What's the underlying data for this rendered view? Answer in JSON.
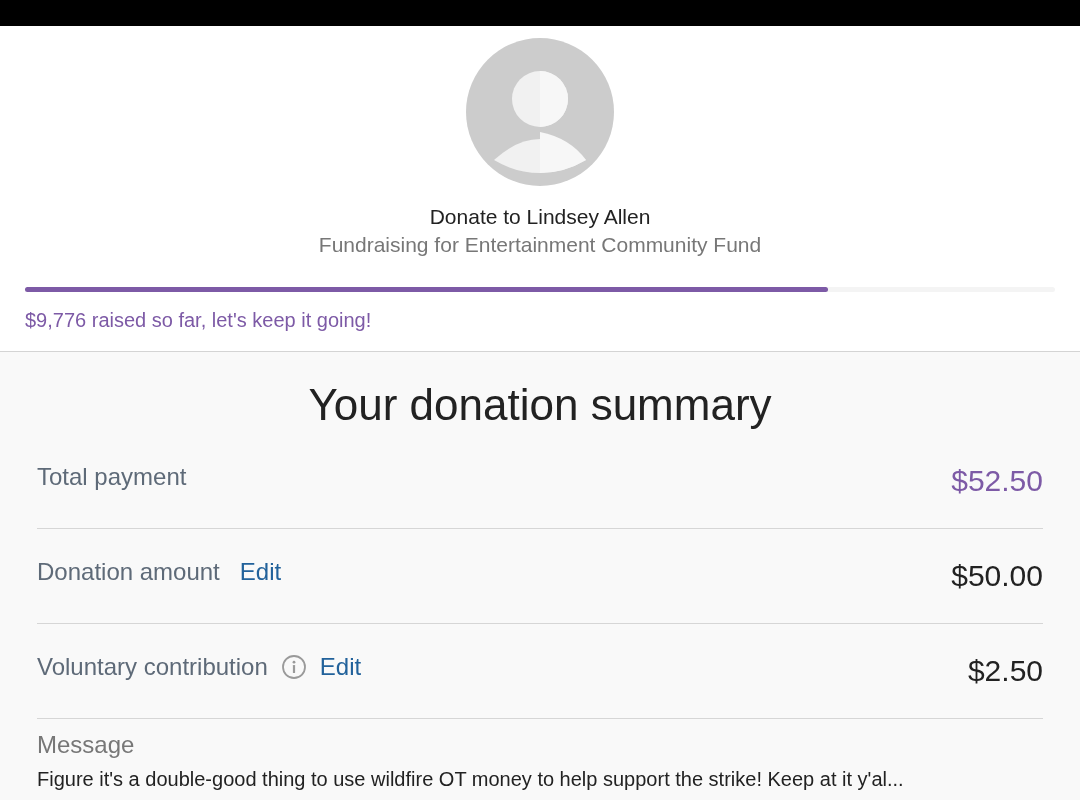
{
  "header": {
    "title": "Donate to Lindsey Allen",
    "subtitle": "Fundraising for Entertainment Community Fund"
  },
  "progress": {
    "level": 0.78,
    "caption": "$9,776 raised so far, let's keep it going!"
  },
  "summary": {
    "title": "Your donation summary",
    "rows": [
      {
        "kind": "total",
        "label": "Total payment",
        "value": "$52.50"
      },
      {
        "kind": "amount",
        "label": "Donation amount",
        "edit": "Edit",
        "value": "$50.00"
      },
      {
        "kind": "amount_info",
        "label": "Voluntary contribution",
        "edit": "Edit",
        "value": "$2.50"
      }
    ],
    "message": {
      "label": "Message",
      "text": "Figure it's a double-good thing to use wildfire OT money to help support the strike! Keep at it y'al..."
    }
  }
}
